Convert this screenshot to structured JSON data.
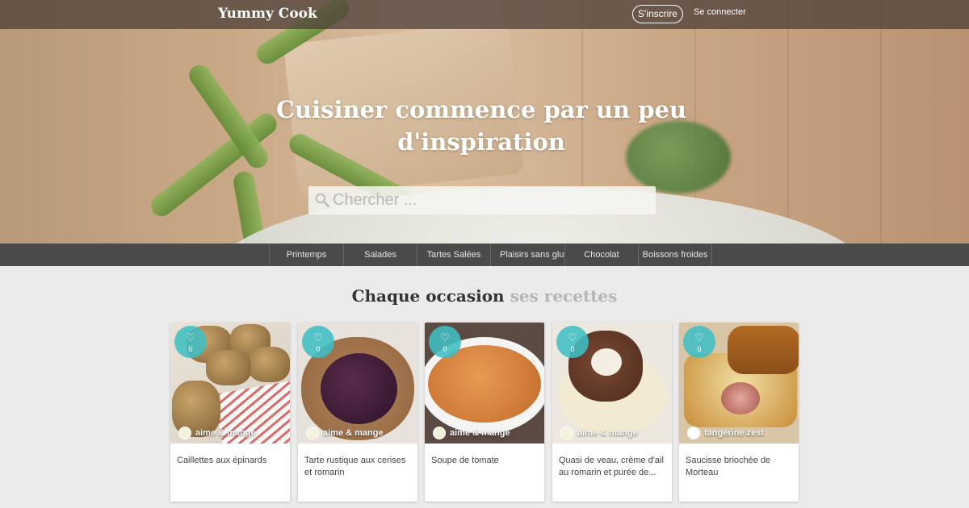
{
  "header": {
    "logo": "Yummy Cook",
    "signup_label": "S'inscrire",
    "login_label": "Se connecter"
  },
  "hero": {
    "headline": "Cuisiner commence par un peu d'inspiration",
    "search_placeholder": "Chercher ..."
  },
  "categories": [
    "Printemps",
    "Salades",
    "Tartes Salées",
    "Plaisirs sans gluten",
    "Chocolat",
    "Boissons froides"
  ],
  "section": {
    "title_dark": "Chaque occasion",
    "title_light": "ses recettes"
  },
  "recipes": [
    {
      "title": "Caillettes aux épinards",
      "author": "aime & mange",
      "likes": "0"
    },
    {
      "title": "Tarte rustique aux cerises et romarin",
      "author": "aime & mange",
      "likes": "0"
    },
    {
      "title": "Soupe de tomate",
      "author": "aime & mange",
      "likes": "0"
    },
    {
      "title": "Quasi de veau, crème d'ail au romarin et purée de...",
      "author": "aime & mange",
      "likes": "0"
    },
    {
      "title": "Saucisse briochée de Morteau",
      "author": "tangerine zest",
      "likes": "0"
    }
  ],
  "colors": {
    "topbar": "#50413a",
    "catbar": "#4a4a4a",
    "like_badge": "#40bec4",
    "page_bg": "#ebebec"
  },
  "icons": {
    "search": "search-icon",
    "like": "heart-icon"
  }
}
